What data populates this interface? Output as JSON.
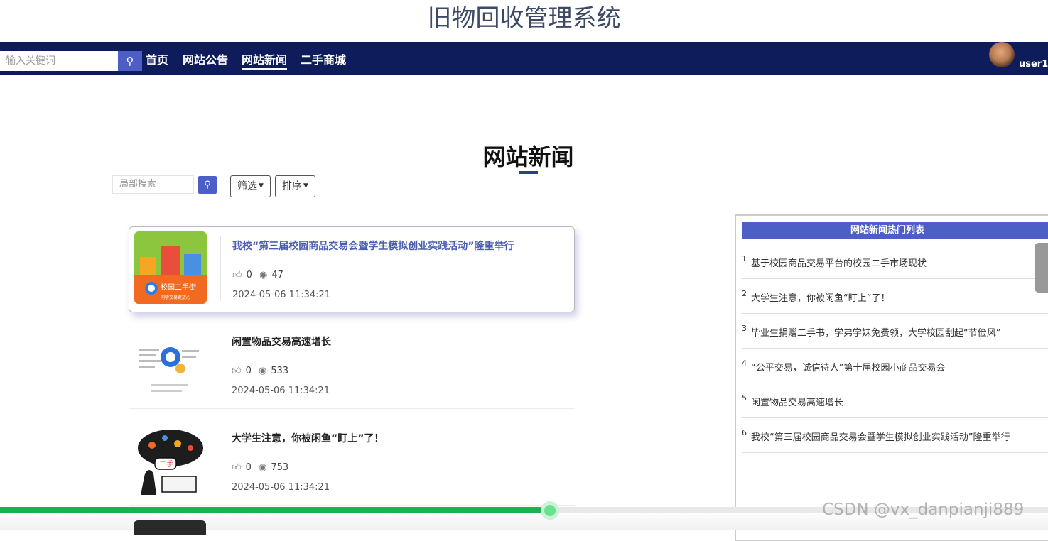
{
  "site": {
    "title": "旧物回收管理系统"
  },
  "nav": {
    "search_placeholder": "输入关键词",
    "items": [
      {
        "label": "首页"
      },
      {
        "label": "网站公告"
      },
      {
        "label": "网站新闻"
      },
      {
        "label": "二手商城"
      }
    ],
    "active_item": "网站新闻",
    "user": "user1"
  },
  "page": {
    "heading": "网站新闻",
    "local_search_placeholder": "局部搜索",
    "filter_label": "筛选",
    "sort_label": "排序"
  },
  "news": [
    {
      "title": "我校“第三届校园商品交易会暨学生模拟创业实践活动”隆重举行",
      "likes": "0",
      "views": "47",
      "date": "2024-05-06 11:34:21"
    },
    {
      "title": "闲置物品交易高速增长",
      "likes": "0",
      "views": "533",
      "date": "2024-05-06 11:34:21"
    },
    {
      "title": "大学生注意，你被闲鱼“盯上”了！",
      "likes": "0",
      "views": "753",
      "date": "2024-05-06 11:34:21"
    }
  ],
  "thumb_labels": {
    "first": "校园二手街",
    "first_sub": "同学交易更放心",
    "third_tag": "二手"
  },
  "hot_list": {
    "header": "网站新闻热门列表",
    "items": [
      {
        "num": "1",
        "title": "基于校园商品交易平台的校园二手市场现状"
      },
      {
        "num": "2",
        "title": "大学生注意，你被闲鱼“盯上”了！"
      },
      {
        "num": "3",
        "title": "毕业生捐赠二手书，学弟学妹免费领，大学校园刮起“节俭风”"
      },
      {
        "num": "4",
        "title": "“公平交易，诚信待人”第十届校园小商品交易会"
      },
      {
        "num": "5",
        "title": "闲置物品交易高速增长"
      },
      {
        "num": "6",
        "title": "我校“第三届校园商品交易会暨学生模拟创业实践活动”隆重举行"
      }
    ]
  },
  "video_progress": 0.525,
  "watermark": "CSDN @vx_danpianji889",
  "colors": {
    "nav_bg": "#0f1c5c",
    "accent": "#4d5fc7",
    "progress": "#18b34f"
  }
}
